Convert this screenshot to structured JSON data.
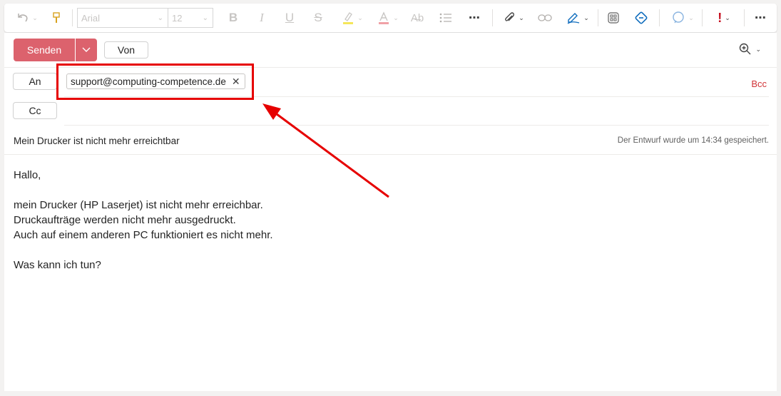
{
  "toolbar": {
    "font_name": "Arial",
    "font_size": "12",
    "icons": [
      "undo-icon",
      "format-painter-icon",
      "bold-icon",
      "italic-icon",
      "underline-icon",
      "strikethrough-icon",
      "highlight-icon",
      "font-color-icon",
      "styles-icon",
      "bullets-icon",
      "more-icon",
      "attach-icon",
      "link-icon",
      "signature-icon",
      "apps-icon",
      "loop-icon",
      "editor-icon",
      "importance-icon",
      "more-options-icon"
    ]
  },
  "compose": {
    "send_label": "Senden",
    "from_label": "Von",
    "to_label": "An",
    "cc_label": "Cc",
    "bcc_label": "Bcc",
    "recipient": "support@computing-competence.de",
    "subject": "Mein Drucker ist nicht mehr erreichtbar",
    "saved_status": "Der Entwurf wurde um 14:34 gespeichert.",
    "body_lines": [
      "Hallo,",
      "",
      "mein Drucker (HP Laserjet) ist nicht mehr erreichbar.",
      "Druckaufträge werden nicht mehr ausgedruckt.",
      "Auch auf einem anderen PC funktioniert es nicht mehr.",
      "",
      "Was kann ich tun?"
    ]
  },
  "colors": {
    "send": "#dc626d",
    "annotation": "#e60000",
    "bcc": "#d13438"
  }
}
